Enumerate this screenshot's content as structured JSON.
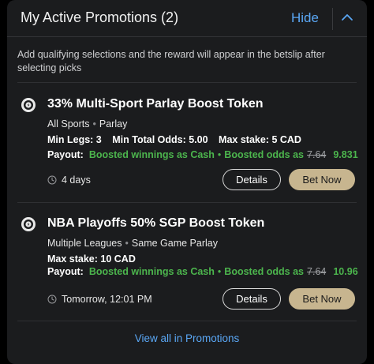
{
  "header": {
    "title": "My Active Promotions (2)",
    "hide_label": "Hide"
  },
  "description": "Add qualifying selections and the reward will appear in the betslip after selecting picks",
  "promotions": [
    {
      "title": "33% Multi-Sport Parlay Boost Token",
      "category": "All Sports",
      "type": "Parlay",
      "limits": [
        "Min Legs: 3",
        "Min Total Odds: 5.00",
        "Max stake: 5 CAD"
      ],
      "payout_label": "Payout:",
      "payout_mode": "Boosted winnings as Cash",
      "boost_label": "Boosted odds as",
      "old_odds": "7.64",
      "new_odds": "9.831",
      "expiry": "4 days",
      "details_label": "Details",
      "bet_label": "Bet Now"
    },
    {
      "title": "NBA Playoffs 50% SGP Boost Token",
      "category": "Multiple Leagues",
      "type": "Same Game Parlay",
      "limits": [
        "Max stake: 10 CAD"
      ],
      "payout_label": "Payout:",
      "payout_mode": "Boosted winnings as Cash",
      "boost_label": "Boosted odds as",
      "old_odds": "7.64",
      "new_odds": "10.96",
      "expiry": "Tomorrow, 12:01 PM",
      "details_label": "Details",
      "bet_label": "Bet Now"
    }
  ],
  "footer": {
    "view_all_label": "View all in Promotions"
  },
  "colors": {
    "accent_link": "#5aa7f5",
    "boost_green": "#4cb54d",
    "bet_button": "#c7b58f"
  }
}
